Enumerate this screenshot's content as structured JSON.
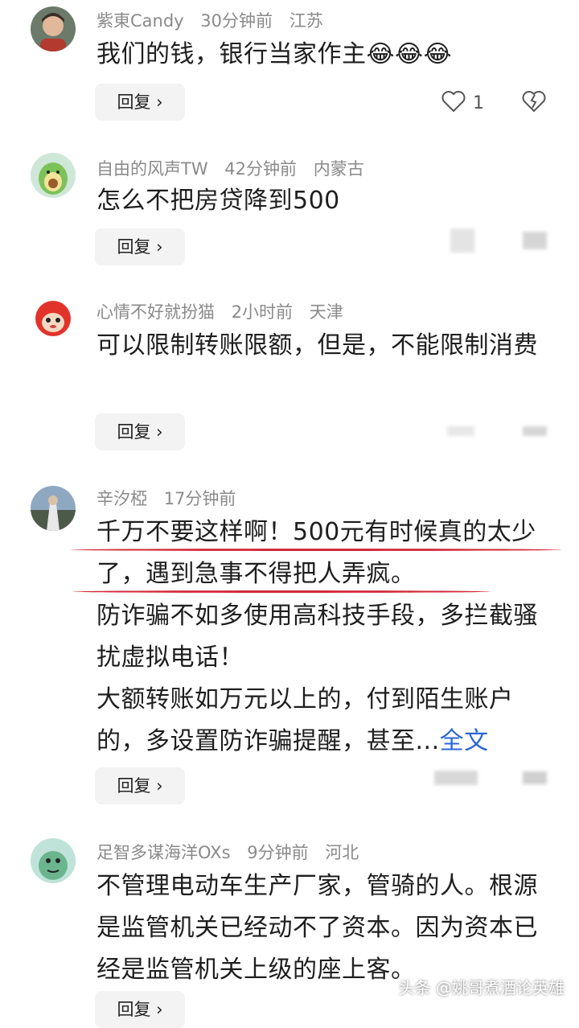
{
  "comments": [
    {
      "username": "紫東Candy",
      "time": "30分钟前",
      "location": "江苏",
      "text": "我们的钱，银行当家作主",
      "emoji": "😂😂😂",
      "reply_label": "回复",
      "like_count": "1"
    },
    {
      "username": "自由的风声TW",
      "time": "42分钟前",
      "location": "内蒙古",
      "text": "怎么不把房贷降到500",
      "reply_label": "回复"
    },
    {
      "username": "心情不好就扮猫",
      "time": "2小时前",
      "location": "天津",
      "text": "可以限制转账限额，但是，不能限制消费",
      "reply_label": "回复"
    },
    {
      "username": "辛汐椏",
      "time": "17分钟前",
      "location": "",
      "text_lines": [
        "千万不要这样啊！500元有时候真的太少了，遇到急事不得把人弄疯。",
        "防诈骗不如多使用高科技手段，多拦截骚扰虚拟电话！",
        "大额转账如万元以上的，付到陌生账户的，多设置防诈骗提醒，甚至..."
      ],
      "more_label": "全文",
      "reply_label": "回复"
    },
    {
      "username": "足智多谋海洋OXs",
      "time": "9分钟前",
      "location": "河北",
      "text": "不管理电动车生产厂家，管骑的人。根源是监管机关已经动不了资本。因为资本已经是监管机关上级的座上客。",
      "reply_label": "回复"
    }
  ],
  "watermark": "头条 @姚哥煮酒论英雄",
  "colors": {
    "underline": "#d22a3a",
    "link": "#2a67d6",
    "meta": "#8a8a8a"
  }
}
